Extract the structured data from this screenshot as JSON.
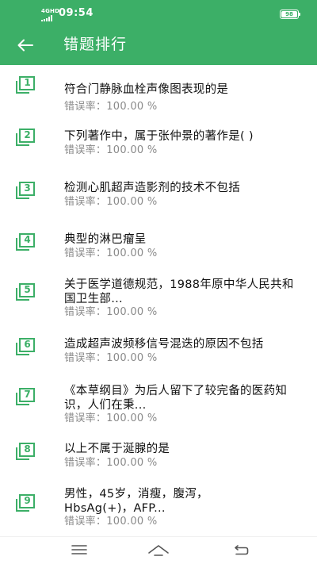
{
  "status_bar": {
    "network": "4GHD",
    "time": "09:54",
    "battery": "98"
  },
  "header": {
    "title": "错题排行"
  },
  "rate_label": "错误率：",
  "items": [
    {
      "rank": "1",
      "title": "符合门静脉血栓声像图表现的是",
      "rate": "100.00 %"
    },
    {
      "rank": "2",
      "title": "下列著作中，属于张仲景的著作是(    )",
      "rate": "100.00 %"
    },
    {
      "rank": "3",
      "title": "检测心肌超声造影剂的技术不包括",
      "rate": "100.00 %"
    },
    {
      "rank": "4",
      "title": "典型的淋巴瘤呈",
      "rate": "100.00 %"
    },
    {
      "rank": "5",
      "title": "关于医学道德规范，1988年原中华人民共和国卫生部...",
      "rate": "100.00 %"
    },
    {
      "rank": "6",
      "title": "造成超声波频移信号混迭的原因不包括",
      "rate": "100.00 %"
    },
    {
      "rank": "7",
      "title": "《本草纲目》为后人留下了较完备的医药知识，人们在秉...",
      "rate": "100.00 %"
    },
    {
      "rank": "8",
      "title": "以上不属于涎腺的是",
      "rate": "100.00 %"
    },
    {
      "rank": "9",
      "title": "男性，45岁，消瘦，腹泻，HbsAg(+)，AFP...",
      "rate": "100.00 %"
    }
  ],
  "colors": {
    "accent": "#3CAF67",
    "title_text": "#111111",
    "rate_text": "#8A8A8A"
  }
}
